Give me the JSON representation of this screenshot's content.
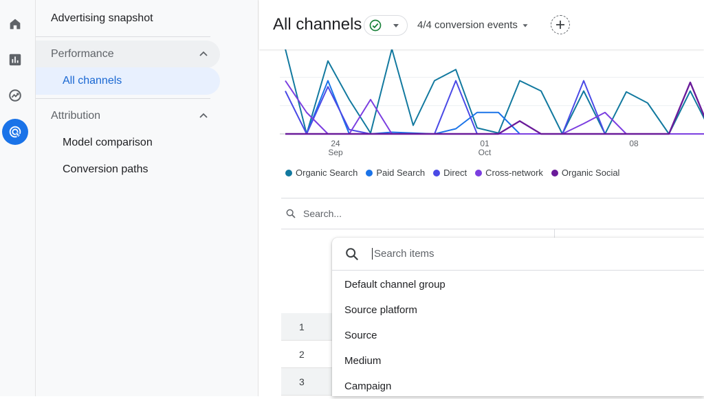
{
  "sidebar": {
    "title": "Advertising snapshot",
    "sections": [
      {
        "label": "Performance",
        "items": [
          "All channels"
        ]
      },
      {
        "label": "Attribution",
        "items": [
          "Model comparison",
          "Conversion paths"
        ]
      }
    ],
    "active_item": "All channels"
  },
  "rail": {
    "icons": [
      "home-icon",
      "reports-icon",
      "explore-icon",
      "advertising-icon"
    ],
    "active": "advertising-icon"
  },
  "header": {
    "title": "All channels",
    "status_icon": "check-circle-icon",
    "conversion_events": "4/4 conversion events"
  },
  "chart_data": {
    "type": "line",
    "x_tick_labels": [
      [
        "24",
        "Sep"
      ],
      [
        "01",
        "Oct"
      ],
      [
        "08",
        ""
      ]
    ],
    "series": [
      {
        "name": "Organic Search",
        "color": "#12799f",
        "values": [
          99,
          0,
          85,
          40,
          1,
          99,
          10,
          62,
          75,
          7,
          1,
          62,
          50,
          0,
          50,
          0,
          49,
          36,
          0,
          50,
          1,
          99,
          53,
          30
        ]
      },
      {
        "name": "Paid Search",
        "color": "#1a73e8",
        "values": [
          0,
          0,
          62,
          0,
          0,
          2,
          1,
          0,
          6,
          25,
          25,
          0,
          0,
          0,
          0,
          0,
          0,
          0,
          0,
          0,
          0,
          38,
          0,
          0
        ]
      },
      {
        "name": "Direct",
        "color": "#4a4ae6",
        "values": [
          50,
          0,
          55,
          5,
          0,
          0,
          0,
          0,
          62,
          0,
          0,
          0,
          0,
          0,
          62,
          0,
          0,
          0,
          0,
          0,
          0,
          80,
          0,
          0
        ]
      },
      {
        "name": "Cross-network",
        "color": "#7b3ee0",
        "values": [
          62,
          25,
          0,
          0,
          40,
          0,
          0,
          0,
          0,
          0,
          0,
          0,
          0,
          0,
          12,
          25,
          0,
          0,
          0,
          0,
          0,
          45,
          0,
          0
        ]
      },
      {
        "name": "Organic Social",
        "color": "#6a1b9a",
        "values": [
          0,
          0,
          0,
          0,
          0,
          0,
          0,
          0,
          0,
          0,
          0,
          15,
          0,
          0,
          0,
          0,
          0,
          0,
          0,
          60,
          0,
          95,
          0,
          0
        ]
      }
    ],
    "legend_position": "bottom-left",
    "grid": true
  },
  "table": {
    "search_placeholder": "Search...",
    "row_numbers": [
      "1",
      "2",
      "3"
    ]
  },
  "dropdown": {
    "search_placeholder": "Search items",
    "items": [
      "Default channel group",
      "Source platform",
      "Source",
      "Medium",
      "Campaign"
    ]
  }
}
